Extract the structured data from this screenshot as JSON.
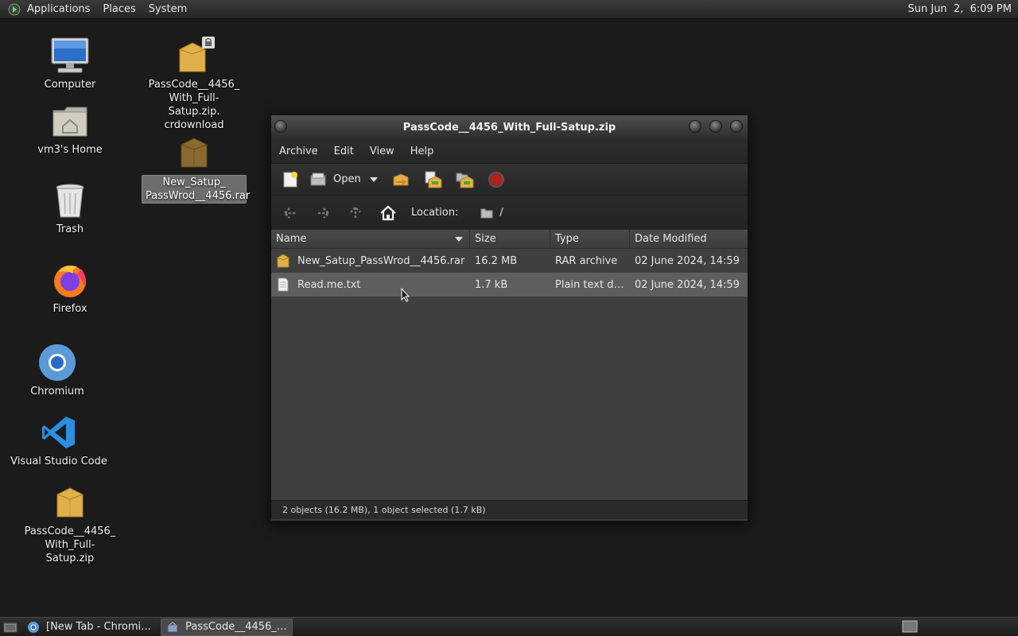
{
  "top_panel": {
    "menus": [
      "Applications",
      "Places",
      "System"
    ],
    "clock": "Sun Jun  2,  6:09 PM"
  },
  "desktop": {
    "icons": [
      {
        "label": "Computer",
        "icon": "computer-icon"
      },
      {
        "label": "vm3's Home",
        "icon": "home-folder-icon"
      },
      {
        "label": "Trash",
        "icon": "trash-icon"
      },
      {
        "label": "Firefox",
        "icon": "firefox-icon"
      },
      {
        "label": "Chromium",
        "icon": "chromium-icon"
      },
      {
        "label": "Visual Studio Code",
        "icon": "vscode-icon"
      },
      {
        "label": "PassCode__4456_ With_Full-Satup.zip",
        "icon": "archive-icon"
      },
      {
        "label": "PassCode__4456_ With_Full-Satup.zip. crdownload",
        "icon": "archive-locked-icon"
      },
      {
        "label": "New_Satup_ PassWrod__4456.rar",
        "icon": "archive-icon",
        "selected": true
      }
    ]
  },
  "window": {
    "title": "PassCode__4456_With_Full-Satup.zip",
    "menu": [
      "Archive",
      "Edit",
      "View",
      "Help"
    ],
    "toolbar": {
      "open_label": "Open",
      "tools": [
        "new-archive-icon",
        "open-icon",
        "dropdown-arrow-icon",
        "extract-icon",
        "add-files-icon",
        "add-folder-icon",
        "stop-icon"
      ]
    },
    "location": {
      "label": "Location:",
      "path": "/"
    },
    "columns": [
      "Name",
      "Size",
      "Type",
      "Date Modified"
    ],
    "files": [
      {
        "name": "New_Satup_PassWrod__4456.rar",
        "size": "16.2 MB",
        "type": "RAR archive",
        "date": "02 June 2024, 14:59",
        "icon": "rar-file-icon"
      },
      {
        "name": "Read.me.txt",
        "size": "1.7 kB",
        "type": "Plain text do…",
        "date": "02 June 2024, 14:59",
        "icon": "text-file-icon",
        "selected": true
      }
    ],
    "status": "2 objects (16.2 MB), 1 object selected (1.7 kB)"
  },
  "taskbar": {
    "tasks": [
      {
        "label": "[New Tab - Chromi…",
        "active": false
      },
      {
        "label": "PassCode__4456_…",
        "active": true
      }
    ]
  },
  "colors": {
    "accent_stop": "#b02020",
    "archive": "#e2b04a",
    "vscode": "#2b8fe0"
  }
}
